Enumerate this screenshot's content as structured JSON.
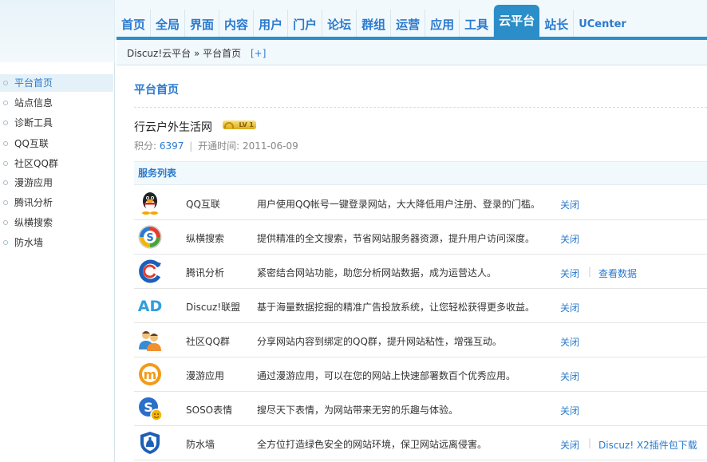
{
  "nav": {
    "items": [
      "首页",
      "全局",
      "界面",
      "内容",
      "用户",
      "门户",
      "论坛",
      "群组",
      "运营",
      "应用",
      "工具",
      "云平台",
      "站长",
      "UCenter"
    ],
    "active": "云平台"
  },
  "sidebar": {
    "items": [
      "平台首页",
      "站点信息",
      "诊断工具",
      "QQ互联",
      "社区QQ群",
      "漫游应用",
      "腾讯分析",
      "纵横搜索",
      "防水墙"
    ],
    "active": "平台首页"
  },
  "breadcrumb": {
    "root": "Discuz!云平台",
    "arrow": "»",
    "current": "平台首页",
    "plus": "[+]"
  },
  "main": {
    "title": "平台首页",
    "site_name": "行云户外生活网",
    "level_badge": "LV 1",
    "points_label": "积分:",
    "points_value": "6397",
    "separator": "|",
    "open_time_label": "开通时间:",
    "open_time_value": "2011-06-09",
    "services_header": "服务列表",
    "services": [
      {
        "icon": "qq-penguin-icon",
        "name": "QQ互联",
        "desc": "用户使用QQ帐号一键登录网站，大大降低用户注册、登录的门槛。",
        "action": "关闭",
        "extra": ""
      },
      {
        "icon": "soso-search-icon",
        "name": "纵横搜索",
        "desc": "提供精准的全文搜索，节省网站服务器资源，提升用户访问深度。",
        "action": "关闭",
        "extra": ""
      },
      {
        "icon": "analytics-icon",
        "name": "腾讯分析",
        "desc": "紧密结合网站功能，助您分析网站数据，成为运营达人。",
        "action": "关闭",
        "extra": "查看数据"
      },
      {
        "icon": "ad-union-icon",
        "name": "Discuz!联盟",
        "desc": "基于海量数据挖掘的精准广告投放系统，让您轻松获得更多收益。",
        "action": "关闭",
        "extra": ""
      },
      {
        "icon": "qq-group-icon",
        "name": "社区QQ群",
        "desc": "分享网站内容到绑定的QQ群，提升网站粘性，增强互动。",
        "action": "关闭",
        "extra": ""
      },
      {
        "icon": "manyou-app-icon",
        "name": "漫游应用",
        "desc": "通过漫游应用，可以在您的网站上快速部署数百个优秀应用。",
        "action": "关闭",
        "extra": ""
      },
      {
        "icon": "soso-emoticon-icon",
        "name": "SOSO表情",
        "desc": "搜尽天下表情，为网站带来无穷的乐趣与体验。",
        "action": "关闭",
        "extra": ""
      },
      {
        "icon": "firewall-shield-icon",
        "name": "防水墙",
        "desc": "全方位打造绿色安全的网站环境，保卫网站远离侵害。",
        "action": "关闭",
        "extra": "Discuz! X2插件包下载"
      }
    ]
  },
  "colors": {
    "accent": "#2b8ec8",
    "link": "#2b7acd",
    "header_bg": "#f2f9fd"
  }
}
